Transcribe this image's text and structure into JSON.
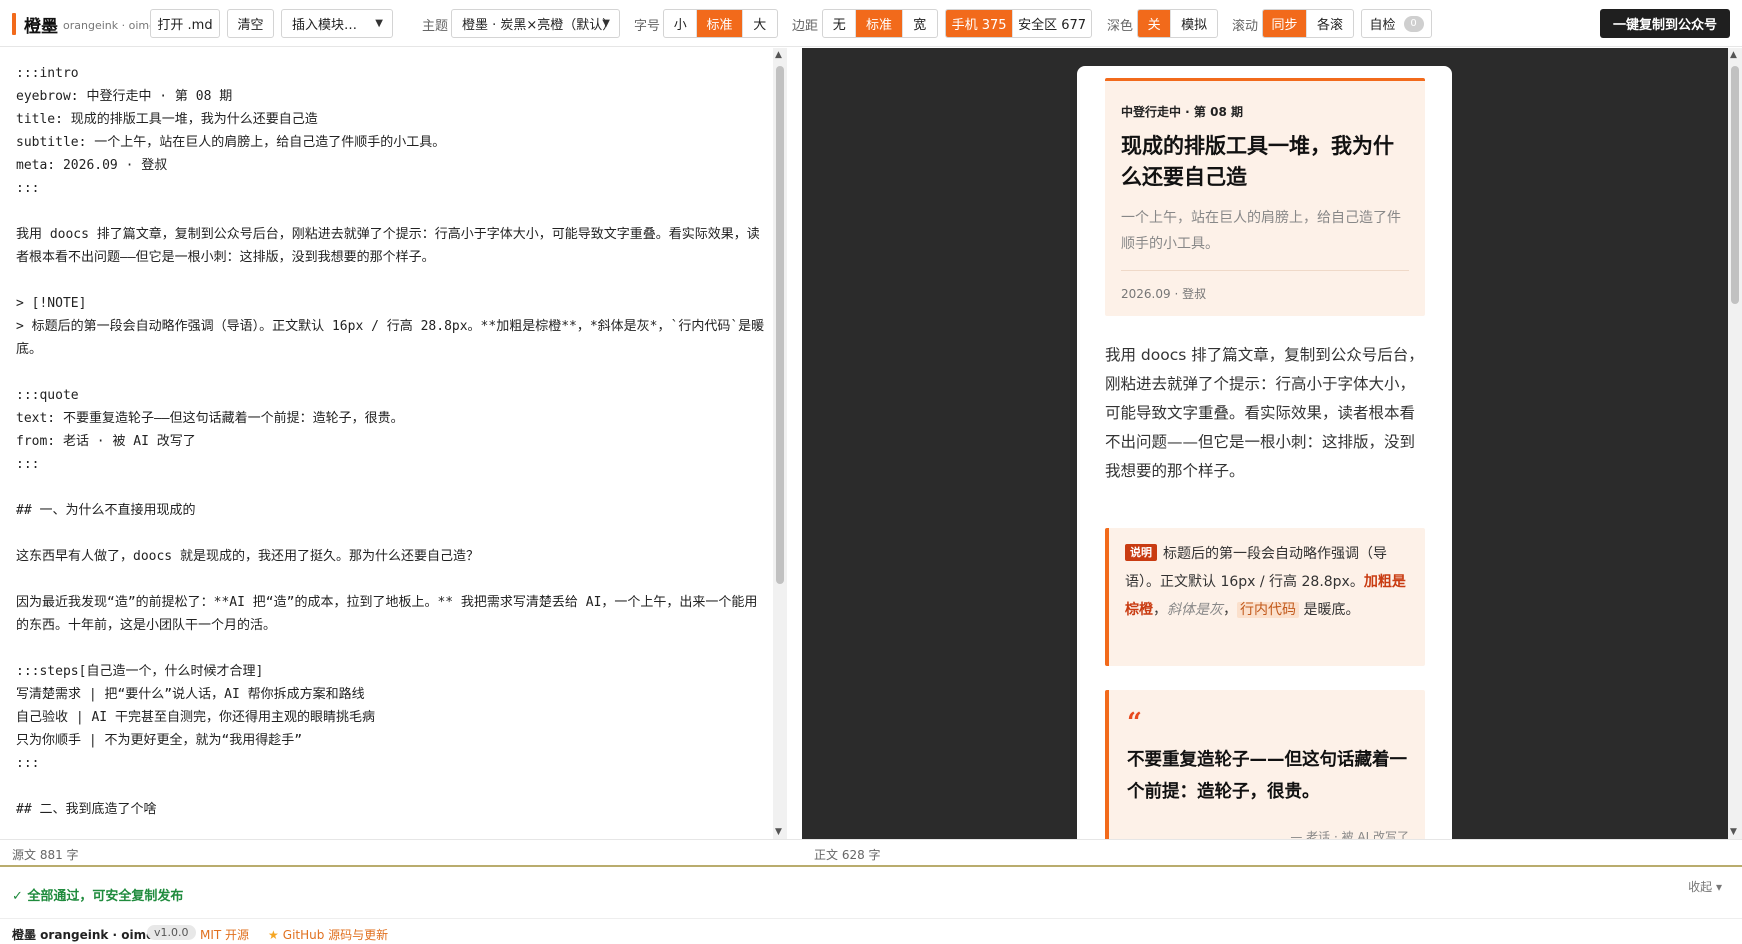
{
  "app": {
    "name": "橙墨",
    "subname": "orangeink · oimd"
  },
  "toolbar": {
    "open_label": "打开 .md",
    "clear_label": "清空",
    "insert_placeholder": "插入模块…",
    "theme_label": "主题",
    "theme_value": "橙墨 · 炭黑×亮橙（默认）",
    "font_label": "字号",
    "font_options": [
      "小",
      "标准",
      "大"
    ],
    "font_selected": "标准",
    "margin_label": "边距",
    "margin_options": [
      "无",
      "标准",
      "宽"
    ],
    "margin_selected": "标准",
    "device_options": [
      "手机 375",
      "安全区 677"
    ],
    "device_selected": "手机 375",
    "dark_label": "深色",
    "dark_options": [
      "关",
      "模拟"
    ],
    "dark_selected": "关",
    "scroll_label": "滚动",
    "scroll_options": [
      "同步",
      "各滚"
    ],
    "scroll_selected": "同步",
    "selfcheck_label": "自检",
    "selfcheck_count": "0",
    "copy_label": "一键复制到公众号"
  },
  "editor": {
    "source": ":::intro\neyebrow: 中登行走中 · 第 08 期\ntitle: 现成的排版工具一堆，我为什么还要自己造\nsubtitle: 一个上午，站在巨人的肩膀上，给自己造了件顺手的小工具。\nmeta: 2026.09 · 登叔\n:::\n\n我用 doocs 排了篇文章，复制到公众号后台，刚粘进去就弹了个提示：行高小于字体大小，可能导致文字重叠。看实际效果，读者根本看不出问题——但它是一根小刺：这排版，没到我想要的那个样子。\n\n> [!NOTE]\n> 标题后的第一段会自动略作强调（导语）。正文默认 16px / 行高 28.8px。**加粗是棕橙**，*斜体是灰*，`行内代码`是暖底。\n\n:::quote\ntext: 不要重复造轮子——但这句话藏着一个前提：造轮子，很贵。\nfrom: 老话 · 被 AI 改写了\n:::\n\n## 一、为什么不直接用现成的\n\n这东西早有人做了，doocs 就是现成的，我还用了挺久。那为什么还要自己造？\n\n因为最近我发现“造”的前提松了：**AI 把“造”的成本，拉到了地板上。** 我把需求写清楚丢给 AI，一个上午，出来一个能用的东西。十年前，这是小团队干一个月的活。\n\n:::steps[自己造一个，什么时候才合理]\n写清楚需求 | 把“要什么”说人话，AI 帮你拆成方案和路线\n自己验收 | AI 干完甚至自测完，你还得用主观的眼睛挑毛病\n只为你顺手 | 不为更好更全，就为“我用得趁手”\n:::\n\n## 二、我到底造了个啥"
  },
  "preview": {
    "intro": {
      "eyebrow": "中登行走中 · 第 08 期",
      "title": "现成的排版工具一堆，我为什么还要自己造",
      "subtitle": "一个上午，站在巨人的肩膀上，给自己造了件顺手的小工具。",
      "meta": "2026.09 · 登叔"
    },
    "lead": "我用 doocs 排了篇文章，复制到公众号后台，刚粘进去就弹了个提示：行高小于字体大小，可能导致文字重叠。看实际效果，读者根本看不出问题——但它是一根小刺：这排版，没到我想要的那个样子。",
    "note": {
      "badge": "说明",
      "text_1": "标题后的第一段会自动略作强调（导语）。正文默认 16px / 行高 28.8px。",
      "bold": "加粗是棕橙",
      "sep_1": "，",
      "italic": "斜体是灰",
      "sep_2": "，",
      "code": "行内代码",
      "text_2": "是暖底。"
    },
    "quote": {
      "mark": "“",
      "text": "不要重复造轮子——但这句话藏着一个前提：造轮子，很贵。",
      "from": "— 老话 · 被 AI 改写了"
    }
  },
  "status": {
    "source_count": "源文 881 字",
    "body_count": "正文 628 字",
    "check_message": "✓ 全部通过，可安全复制发布",
    "collapse_label": "收起 ▾"
  },
  "footer": {
    "brand": "橙墨 orangeink · oimd",
    "version": "v1.0.0",
    "license": "MIT 开源",
    "github": "GitHub 源码与更新"
  },
  "colors": {
    "accent": "#f26a1b",
    "preview_bg": "#2b2b2b",
    "warm_bg": "#fdf1e8",
    "ok_green": "#1f8b3d",
    "bold_orange": "#c93c12"
  }
}
